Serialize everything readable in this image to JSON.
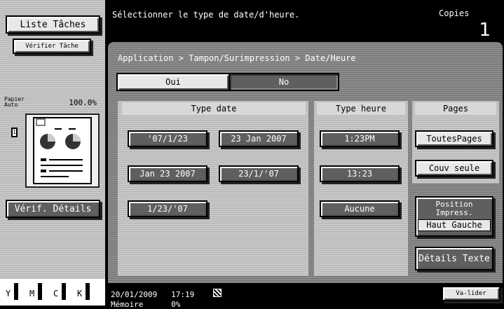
{
  "top": {
    "job_list_button": "Liste Tâches",
    "verify_job_button": "Vérifier Tâche",
    "message": "Sélectionner le type de date/d'heure.",
    "copies_label": "Copies",
    "copies_value": "1"
  },
  "sidebar": {
    "paper_label": "Papier Auto",
    "zoom": "100.0%",
    "check_details_button": "Vérif. Détails",
    "toner": [
      "Y",
      "M",
      "C",
      "K"
    ]
  },
  "breadcrumb": "Application > Tampon/Surimpression > Date/Heure",
  "toggle": {
    "yes": "Oui",
    "no": "No",
    "selected": "No"
  },
  "date_type": {
    "header": "Type date",
    "options": [
      "'07/1/23",
      "23 Jan 2007",
      "Jan 23 2007",
      "23/1/'07",
      "1/23/'07"
    ],
    "selected": "'07/1/23"
  },
  "time_type": {
    "header": "Type heure",
    "options": [
      "1:23PM",
      "13:23",
      "Aucune"
    ],
    "selected": "1:23PM"
  },
  "pages": {
    "header": "Pages",
    "options": [
      "ToutesPages",
      "Couv seule"
    ],
    "selected": "ToutesPages",
    "position_title": "Position Impress.",
    "position_value": "Haut Gauche",
    "text_details_button": "Détails Texte"
  },
  "status": {
    "datetime": "20/01/2009   17:19",
    "memory": "Mémoire      0%",
    "validate_button": "Va-lider"
  },
  "colors": {
    "screen_bg": "#000000",
    "button_dark": "#5f5f5f",
    "button_light": "#e8e8e8"
  }
}
